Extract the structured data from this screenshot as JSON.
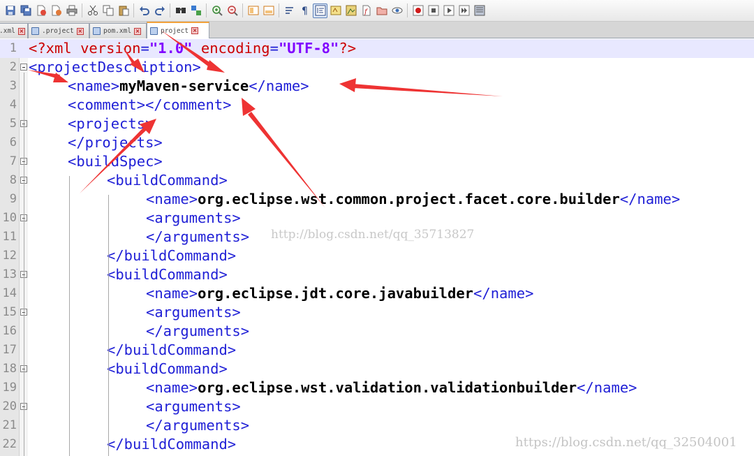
{
  "toolbar": {
    "icons": [
      "save-icon",
      "save-all-icon",
      "close-file-icon",
      "close-all-icon",
      "print-icon",
      "cut-icon",
      "copy-icon",
      "paste-icon",
      "undo-icon",
      "redo-icon",
      "find-icon",
      "replace-icon",
      "zoom-in-icon",
      "zoom-out-icon",
      "sync-vertical-icon",
      "sync-horizontal-icon",
      "word-wrap-icon",
      "show-all-chars-icon",
      "indent-guide-icon",
      "user-lang-icon",
      "doc-map-icon",
      "function-list-icon",
      "folder-workspace-icon",
      "monitoring-icon",
      "record-macro-icon",
      "stop-macro-icon",
      "play-macro-icon",
      "run-macro-icon",
      "save-macro-icon"
    ]
  },
  "tabs": [
    {
      "label": ".xml"
    },
    {
      "label": ".project"
    },
    {
      "label": "pom.xml"
    },
    {
      "label": "project"
    }
  ],
  "editor": {
    "line_numbers": [
      "1",
      "2",
      "3",
      "4",
      "5",
      "6",
      "7",
      "8",
      "9",
      "10",
      "11",
      "12",
      "13",
      "14",
      "15",
      "16",
      "17",
      "18",
      "19",
      "20",
      "21",
      "22"
    ],
    "lines": [
      {
        "parts": [
          "<?xml ",
          "version",
          "=",
          "\"1.0\"",
          " encoding",
          "=",
          "\"UTF-8\"",
          "?>"
        ]
      },
      {
        "parts": [
          "<projectDescription>"
        ]
      },
      {
        "parts": [
          "<name>",
          "myMaven-service",
          "</name>"
        ]
      },
      {
        "parts": [
          "<comment></comment>"
        ]
      },
      {
        "parts": [
          "<projects>"
        ]
      },
      {
        "parts": [
          "</projects>"
        ]
      },
      {
        "parts": [
          "<buildSpec>"
        ]
      },
      {
        "parts": [
          "<buildCommand>"
        ]
      },
      {
        "parts": [
          "<name>",
          "org.eclipse.wst.common.project.facet.core.builder",
          "</name>"
        ]
      },
      {
        "parts": [
          "<arguments>"
        ]
      },
      {
        "parts": [
          "</arguments>"
        ]
      },
      {
        "parts": [
          "</buildCommand>"
        ]
      },
      {
        "parts": [
          "<buildCommand>"
        ]
      },
      {
        "parts": [
          "<name>",
          "org.eclipse.jdt.core.javabuilder",
          "</name>"
        ]
      },
      {
        "parts": [
          "<arguments>"
        ]
      },
      {
        "parts": [
          "</arguments>"
        ]
      },
      {
        "parts": [
          "</buildCommand>"
        ]
      },
      {
        "parts": [
          "<buildCommand>"
        ]
      },
      {
        "parts": [
          "<name>",
          "org.eclipse.wst.validation.validationbuilder",
          "</name>"
        ]
      },
      {
        "parts": [
          "<arguments>"
        ]
      },
      {
        "parts": [
          "</arguments>"
        ]
      },
      {
        "parts": [
          "</buildCommand>"
        ]
      }
    ]
  },
  "watermarks": {
    "mid": "http://blog.csdn.net/qq_35713827",
    "corner": "https://blog.csdn.net/qq_32504001"
  },
  "colors": {
    "tag": "#1f1fd6",
    "attribute": "#cc0000",
    "attr_value": "#8000ff",
    "text": "#000000",
    "arrow": "#ee3333",
    "current_line": "#e8e8ff"
  }
}
